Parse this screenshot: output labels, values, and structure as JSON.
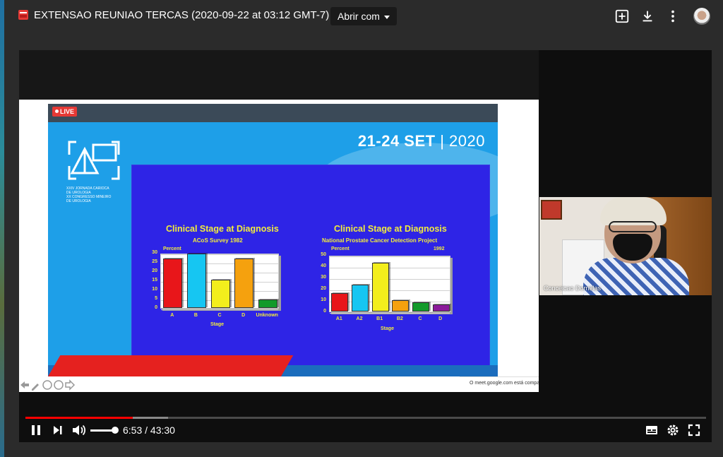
{
  "header": {
    "file_title": "EXTENSAO REUNIAO TERCAS (2020-09-22 at 03:12 GMT-7)",
    "open_with_label": "Abrir com",
    "icons": [
      "add-to-drive-icon",
      "download-icon",
      "more-vert-icon",
      "avatar"
    ]
  },
  "slide": {
    "live_label": "LIVE",
    "date_main": "21-24 SET",
    "date_sep": " | ",
    "date_year": "2020",
    "logo_lines": [
      "XXIV JORNADA CARIOCA",
      "DE UROLOGIA",
      "XX CONGRESSO MINEIRO",
      "DE UROLOGIA"
    ],
    "notification": "O meet.google.com está comparti"
  },
  "chart_data": [
    {
      "type": "bar",
      "title": "Clinical Stage at Diagnosis",
      "subtitle": "ACoS Survey 1982",
      "ylabel": "Percent",
      "xlabel": "Stage",
      "ylim": [
        0,
        30
      ],
      "yticks": [
        "30",
        "25",
        "20",
        "15",
        "10",
        "5",
        "0"
      ],
      "categories": [
        "A",
        "B",
        "C",
        "D",
        "Unknown"
      ],
      "values": [
        27,
        29.5,
        15.5,
        27,
        4.5
      ],
      "colors": [
        "#e8161a",
        "#16c6f2",
        "#f3ee1c",
        "#f5a10e",
        "#139a2a"
      ]
    },
    {
      "type": "bar",
      "title": "Clinical Stage at Diagnosis",
      "subtitle": "National Prostate Cancer Detection Project",
      "ylabel": "Percent",
      "note": "1992",
      "xlabel": "Stage",
      "ylim": [
        0,
        50
      ],
      "yticks": [
        "50",
        "40",
        "30",
        "20",
        "10",
        "0"
      ],
      "categories": [
        "A1",
        "A2",
        "B1",
        "B2",
        "C",
        "D"
      ],
      "values": [
        16,
        24,
        43,
        10,
        8,
        6
      ],
      "colors": [
        "#e8161a",
        "#16c6f2",
        "#f3ee1c",
        "#f5a10e",
        "#139a2a",
        "#8b1a9a"
      ]
    }
  ],
  "camera": {
    "participant_name": "Conceicao Dornelas"
  },
  "player": {
    "current_time": "6:53",
    "separator": " / ",
    "duration": "43:30",
    "progress_fraction": 0.158,
    "buffered_fraction": 0.21,
    "volume_fraction": 1.0
  }
}
